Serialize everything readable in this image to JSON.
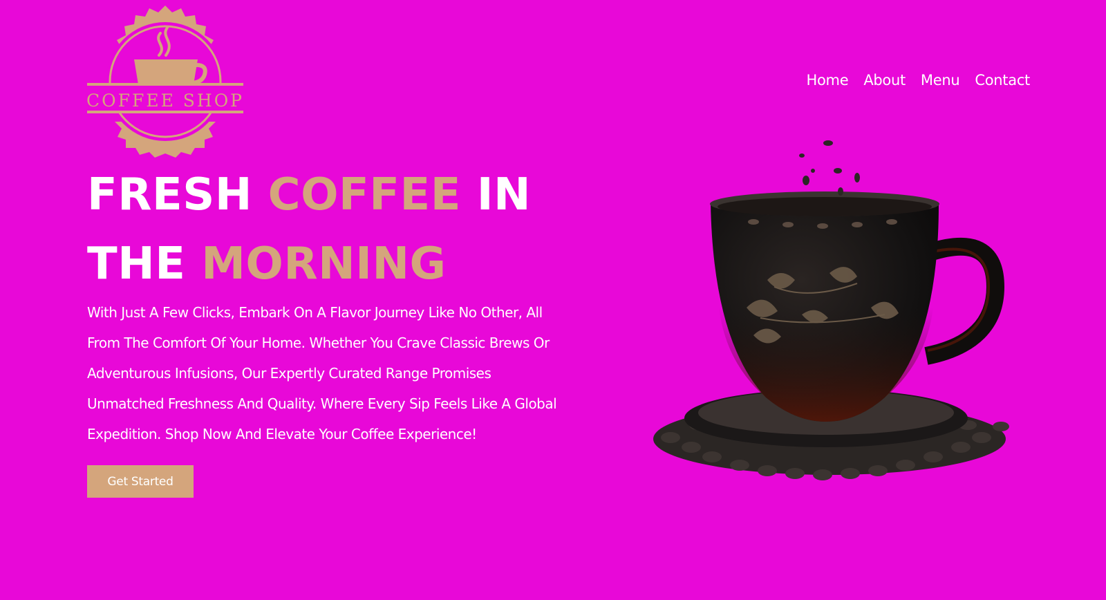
{
  "brand": {
    "logo_text": "COFFEE SHOP",
    "logo_color": "#d4a57c"
  },
  "nav": {
    "items": [
      "Home",
      "About",
      "Menu",
      "Contact"
    ]
  },
  "hero": {
    "line1_part1": "FRESH ",
    "line1_accent": "COFFEE",
    "line1_part2": " IN",
    "line2_part1": "THE ",
    "line2_accent": "MORNING",
    "description": "With Just A Few Clicks, Embark On A Flavor Journey Like No Other, All From The Comfort Of Your Home. Whether You Crave Classic Brews Or Adventurous Infusions, Our Expertly Curated Range Promises Unmatched Freshness And Quality. Where Every Sip Feels Like A Global Expedition. Shop Now And Elevate Your Coffee Experience!",
    "cta_label": "Get Started"
  },
  "colors": {
    "background": "#e808d8",
    "accent": "#d4a57c",
    "text": "#ffffff"
  },
  "icons": {
    "logo": "coffee-cup-badge-icon",
    "hero_image": "coffee-cup-illustration"
  }
}
